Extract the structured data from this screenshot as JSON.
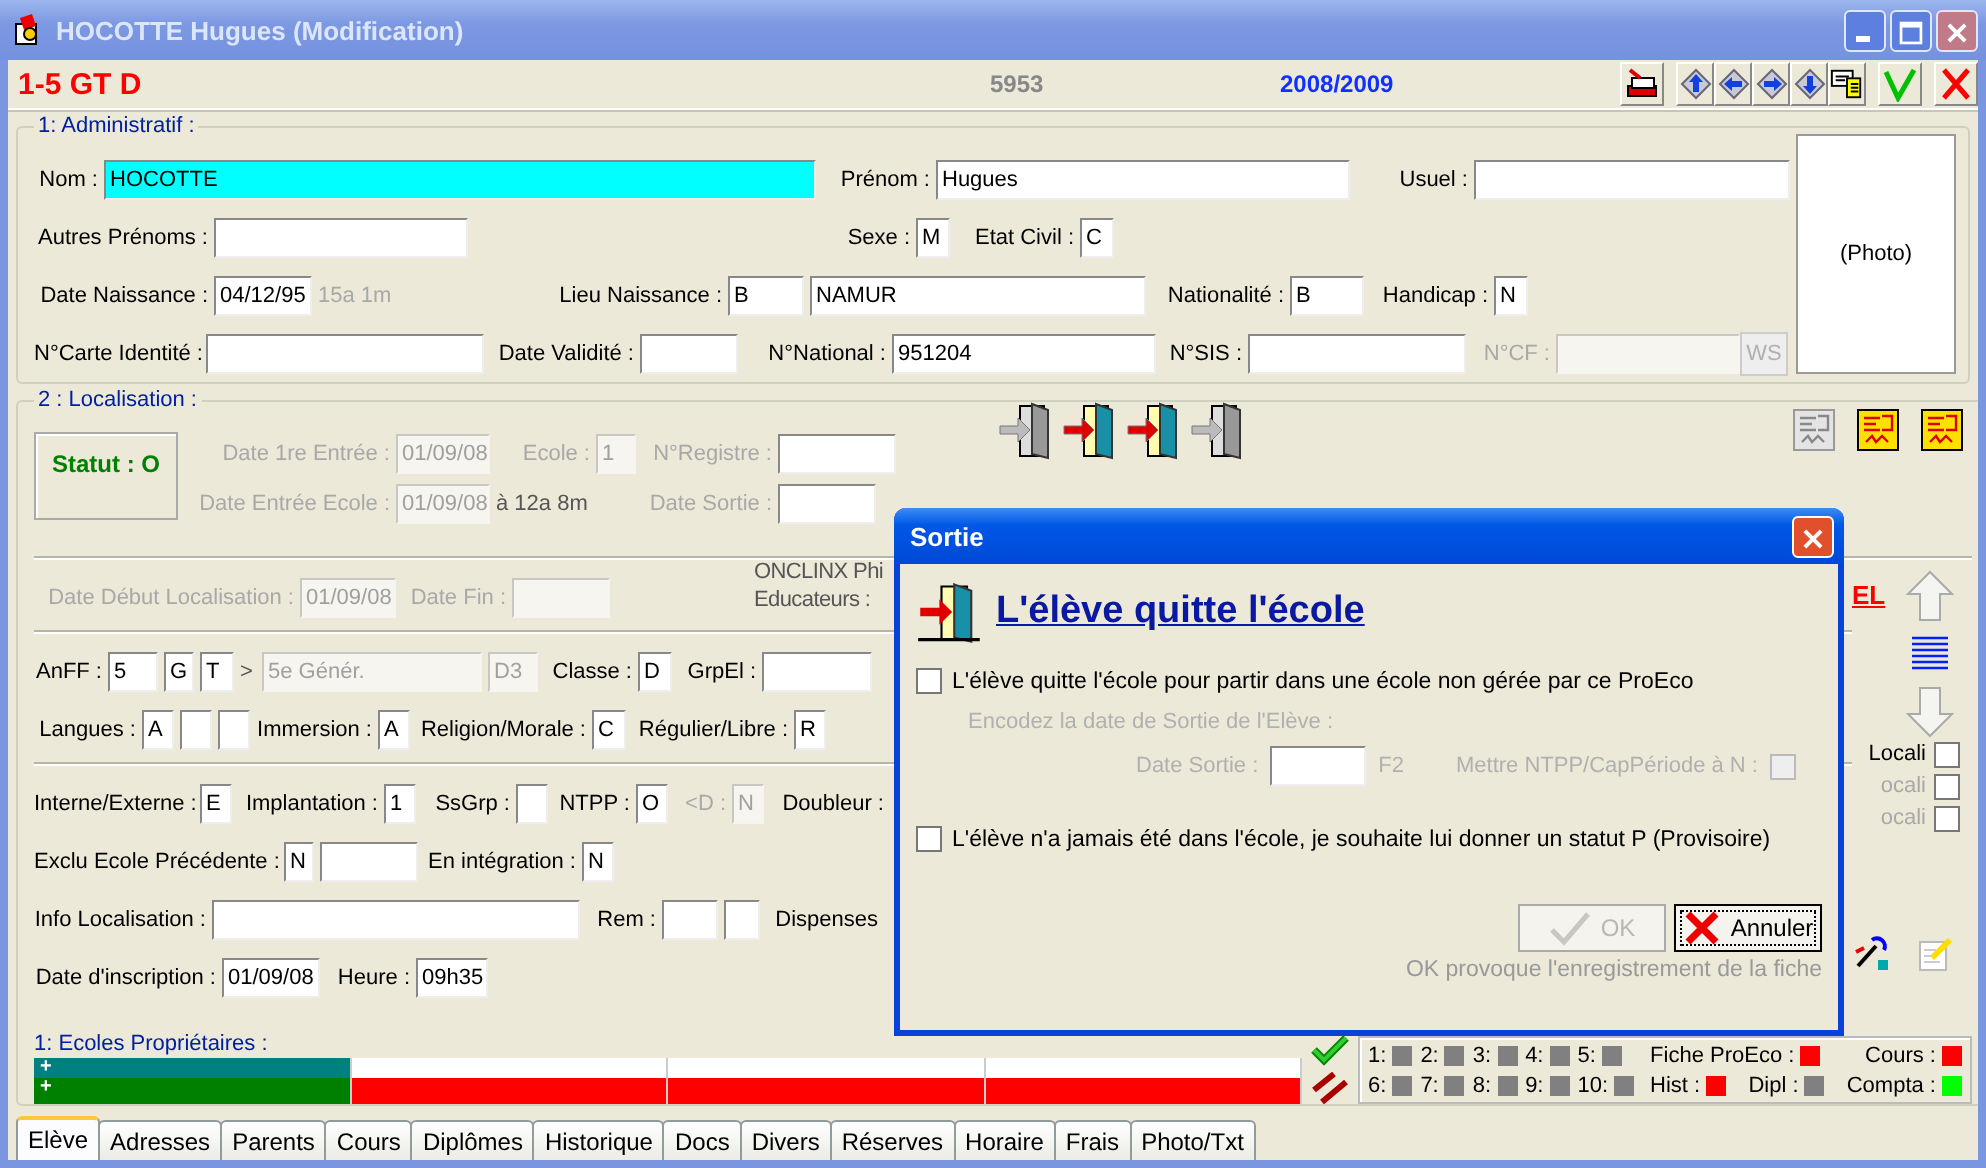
{
  "window": {
    "title": "HOCOTTE Hugues (Modification)"
  },
  "header": {
    "class_code": "1-5 GT D",
    "number": "5953",
    "school_year": "2008/2009"
  },
  "admin": {
    "legend": "1: Administratif :",
    "photo": "(Photo)",
    "rows": [
      {
        "items": [
          {
            "kind": "label",
            "text": "Nom :",
            "disabled": false
          },
          {
            "kind": "active_field",
            "value": "HOCOTTE",
            "disabled": false
          },
          {
            "kind": "label",
            "text": "Prénom :",
            "disabled": false
          },
          {
            "kind": "field",
            "value": "Hugues",
            "disabled": false
          },
          {
            "kind": "label",
            "text": "Usuel :",
            "disabled": false
          },
          {
            "kind": "field",
            "disabled": false
          }
        ]
      },
      {
        "items": [
          {
            "kind": "label",
            "text": "Autres Prénoms :",
            "disabled": false
          },
          {
            "kind": "field",
            "disabled": false
          },
          {
            "kind": "label",
            "text": "Sexe :",
            "disabled": false
          },
          {
            "kind": "field",
            "value": "M",
            "disabled": false
          },
          {
            "kind": "label",
            "text": "Etat Civil :",
            "disabled": false
          },
          {
            "kind": "field",
            "value": "C",
            "disabled": false
          }
        ]
      },
      {
        "items": [
          {
            "kind": "label",
            "text": "Date Naissance :",
            "disabled": false
          },
          {
            "kind": "field",
            "value": "04/12/95",
            "disabled": false
          },
          {
            "kind": "note",
            "text": "15a 1m",
            "disabled": true
          },
          {
            "kind": "label",
            "text": "Lieu Naissance :",
            "disabled": false
          },
          {
            "kind": "field",
            "value": "B",
            "disabled": false
          },
          {
            "kind": "field",
            "value": "NAMUR",
            "disabled": false
          },
          {
            "kind": "label",
            "text": "Nationalité :",
            "disabled": false
          },
          {
            "kind": "field",
            "value": "B",
            "disabled": false
          },
          {
            "kind": "label",
            "text": "Handicap :",
            "disabled": false
          },
          {
            "kind": "field",
            "value": "N",
            "disabled": false
          }
        ]
      },
      {
        "items": [
          {
            "kind": "label",
            "text": "N°Carte Identité :",
            "disabled": false
          },
          {
            "kind": "field",
            "disabled": false
          },
          {
            "kind": "label",
            "text": "Date Validité :",
            "disabled": false
          },
          {
            "kind": "field",
            "disabled": false
          },
          {
            "kind": "label",
            "text": "N°National :",
            "disabled": false
          },
          {
            "kind": "field",
            "value": "951204",
            "disabled": false
          },
          {
            "kind": "label",
            "text": "N°SIS :",
            "disabled": false
          },
          {
            "kind": "field",
            "disabled": false
          },
          {
            "kind": "label",
            "text": "N°CF :",
            "disabled": true
          },
          {
            "kind": "field",
            "disabled": true
          },
          {
            "kind": "button",
            "text": "WS",
            "disabled": true
          }
        ]
      }
    ]
  },
  "localisation": {
    "legend": "2 : Localisation :",
    "status": "Statut : O",
    "top_rows": [
      {
        "items": [
          {
            "kind": "label",
            "text": "Date 1re Entrée :",
            "disabled": true
          },
          {
            "kind": "field",
            "value": "01/09/08",
            "disabled": true
          },
          {
            "kind": "label",
            "text": "Ecole :",
            "disabled": true
          },
          {
            "kind": "field",
            "value": "1",
            "disabled": true
          },
          {
            "kind": "label",
            "text": "N°Registre :",
            "disabled": true
          },
          {
            "kind": "field",
            "disabled": false
          }
        ]
      },
      {
        "items": [
          {
            "kind": "label",
            "text": "Date Entrée Ecole :",
            "disabled": true
          },
          {
            "kind": "field",
            "value": "01/09/08",
            "disabled": true
          },
          {
            "kind": "note",
            "text": "à 12a 8m",
            "disabled": false
          },
          {
            "kind": "label",
            "text": "Date Sortie :",
            "disabled": true
          },
          {
            "kind": "field",
            "disabled": false
          }
        ]
      }
    ],
    "door_buttons": [
      {
        "disabled": true
      },
      {
        "disabled": false
      },
      {
        "disabled": false
      },
      {
        "disabled": true
      }
    ],
    "report_buttons": [
      {
        "disabled": true
      },
      {
        "disabled": false
      },
      {
        "disabled": false
      }
    ],
    "period_row": {
      "items": [
        {
          "kind": "label",
          "text": "Date Début Localisation :",
          "disabled": true
        },
        {
          "kind": "field",
          "value": "01/09/08",
          "disabled": true
        },
        {
          "kind": "label",
          "text": "Date Fin :",
          "disabled": true
        },
        {
          "kind": "field",
          "disabled": true
        }
      ]
    },
    "educators": {
      "name": "ONCLINX Phi",
      "label": "Educateurs :"
    },
    "rows": [
      {
        "items": [
          {
            "kind": "label",
            "text": "AnFF :",
            "disabled": false
          },
          {
            "kind": "field",
            "value": "5",
            "disabled": false
          },
          {
            "kind": "field",
            "value": "G",
            "disabled": false
          },
          {
            "kind": "field",
            "value": "T",
            "disabled": false
          },
          {
            "kind": "note",
            "text": ">",
            "disabled": false
          },
          {
            "kind": "field",
            "value": "5e Génér.",
            "disabled": true
          },
          {
            "kind": "field",
            "value": "D3",
            "disabled": true
          },
          {
            "kind": "label",
            "text": "Classe :",
            "disabled": false
          },
          {
            "kind": "field",
            "value": "D",
            "disabled": false
          },
          {
            "kind": "label",
            "text": "GrpEl :",
            "disabled": false
          },
          {
            "kind": "field",
            "disabled": false
          }
        ]
      },
      {
        "items": [
          {
            "kind": "label",
            "text": "Langues :",
            "disabled": false
          },
          {
            "kind": "field",
            "value": "A",
            "disabled": false
          },
          {
            "kind": "field",
            "disabled": false
          },
          {
            "kind": "field",
            "disabled": false
          },
          {
            "kind": "label",
            "text": "Immersion :",
            "disabled": false
          },
          {
            "kind": "field",
            "value": "A",
            "disabled": false
          },
          {
            "kind": "label",
            "text": "Religion/Morale :",
            "disabled": false
          },
          {
            "kind": "field",
            "value": "C",
            "disabled": false
          },
          {
            "kind": "label",
            "text": "Régulier/Libre :",
            "disabled": false
          },
          {
            "kind": "field",
            "value": "R",
            "disabled": false
          }
        ]
      },
      {
        "items": [
          {
            "kind": "label",
            "text": "Interne/Externe :",
            "disabled": false
          },
          {
            "kind": "field",
            "value": "E",
            "disabled": false
          },
          {
            "kind": "label",
            "text": "Implantation :",
            "disabled": false
          },
          {
            "kind": "field",
            "value": "1",
            "disabled": false
          },
          {
            "kind": "label",
            "text": "SsGrp :",
            "disabled": false
          },
          {
            "kind": "field",
            "disabled": false
          },
          {
            "kind": "label",
            "text": "NTPP :",
            "disabled": false
          },
          {
            "kind": "field",
            "value": "O",
            "disabled": false
          },
          {
            "kind": "label",
            "text": "<D :",
            "disabled": true
          },
          {
            "kind": "field",
            "value": "N",
            "disabled": true
          },
          {
            "kind": "label",
            "text": "Doubleur :",
            "disabled": false
          }
        ]
      },
      {
        "items": [
          {
            "kind": "label",
            "text": "Exclu Ecole Précédente :",
            "disabled": false
          },
          {
            "kind": "field",
            "value": "N",
            "disabled": false
          },
          {
            "kind": "field",
            "disabled": false
          },
          {
            "kind": "label",
            "text": "En intégration :",
            "disabled": false
          },
          {
            "kind": "field",
            "value": "N",
            "disabled": false
          }
        ]
      },
      {
        "items": [
          {
            "kind": "label",
            "text": "Info Localisation :",
            "disabled": false
          },
          {
            "kind": "field",
            "disabled": false
          },
          {
            "kind": "label",
            "text": "Rem :",
            "disabled": false
          },
          {
            "kind": "field",
            "disabled": false
          },
          {
            "kind": "field",
            "disabled": false
          },
          {
            "kind": "label",
            "text": "Dispenses",
            "disabled": false
          }
        ]
      },
      {
        "items": [
          {
            "kind": "label",
            "text": "Date d'inscription :",
            "disabled": false
          },
          {
            "kind": "field",
            "value": "01/09/08",
            "disabled": false
          },
          {
            "kind": "label",
            "text": "Heure :",
            "disabled": false
          },
          {
            "kind": "field",
            "value": "09h35",
            "disabled": false
          }
        ]
      }
    ],
    "side_panel": {
      "link": "EL",
      "options": [
        {
          "label": "Locali",
          "disabled": false,
          "checked": false
        },
        {
          "label": "ocali",
          "disabled": true,
          "checked": false
        },
        {
          "label": "ocali",
          "disabled": true,
          "checked": false
        }
      ]
    }
  },
  "owners": {
    "legend": "1: Ecoles Propriétaires :",
    "rows": [
      {
        "cells": [
          {
            "color": "#008080",
            "marker": "+"
          },
          {
            "color": "#ffffff"
          },
          {
            "color": "#ffffff"
          },
          {
            "color": "#ffffff"
          }
        ]
      },
      {
        "cells": [
          {
            "color": "#008000",
            "marker": "+"
          },
          {
            "color": "#ff0000"
          },
          {
            "color": "#ff0000"
          },
          {
            "color": "#ff0000"
          }
        ]
      }
    ]
  },
  "indicators": {
    "slots": [
      {
        "label": "1:",
        "color": "#808080"
      },
      {
        "label": "2:",
        "color": "#808080"
      },
      {
        "label": "3:",
        "color": "#808080"
      },
      {
        "label": "4:",
        "color": "#808080"
      },
      {
        "label": "5:",
        "color": "#808080"
      },
      {
        "label": "6:",
        "color": "#808080"
      },
      {
        "label": "7:",
        "color": "#808080"
      },
      {
        "label": "8:",
        "color": "#808080"
      },
      {
        "label": "9:",
        "color": "#808080"
      },
      {
        "label": "10:",
        "color": "#808080"
      }
    ],
    "flag_rows": [
      [
        {
          "label": "Fiche ProEco :",
          "color": "#ff0000"
        },
        {
          "label": "Cours :",
          "color": "#ff0000"
        }
      ],
      [
        {
          "label": "Hist :",
          "color": "#ff0000"
        },
        {
          "label": "Dipl :",
          "color": "#808080"
        },
        {
          "label": "Compta :",
          "color": "#00ff00"
        }
      ]
    ]
  },
  "tabs": [
    {
      "label": "Elève",
      "selected": true
    },
    {
      "label": "Adresses",
      "selected": false
    },
    {
      "label": "Parents",
      "selected": false
    },
    {
      "label": "Cours",
      "selected": false
    },
    {
      "label": "Diplômes",
      "selected": false
    },
    {
      "label": "Historique",
      "selected": false
    },
    {
      "label": "Docs",
      "selected": false
    },
    {
      "label": "Divers",
      "selected": false
    },
    {
      "label": "Réserves",
      "selected": false
    },
    {
      "label": "Horaire",
      "selected": false
    },
    {
      "label": "Frais",
      "selected": false
    },
    {
      "label": "Photo/Txt",
      "selected": false
    }
  ],
  "dialog": {
    "title": "Sortie",
    "heading": "L'élève quitte l'école",
    "option_1": {
      "label": "L'élève quitte l'école pour partir dans une école non gérée par ce ProEco",
      "checked": false
    },
    "prompt": "Encodez la date de Sortie de l'Elève :",
    "date_label": "Date Sortie :",
    "key_hint": "F2",
    "ntpp": {
      "label": "Mettre NTPP/CapPériode à N :",
      "checked": false
    },
    "option_2": {
      "label": "L'élève n'a jamais été dans l'école, je souhaite lui donner un statut P (Provisoire)",
      "checked": false
    },
    "buttons": [
      {
        "kind": "ok",
        "label": "OK",
        "disabled": true
      },
      {
        "kind": "cancel",
        "label": "Annuler",
        "disabled": false
      }
    ],
    "footer": "OK provoque l'enregistrement de la fiche"
  }
}
